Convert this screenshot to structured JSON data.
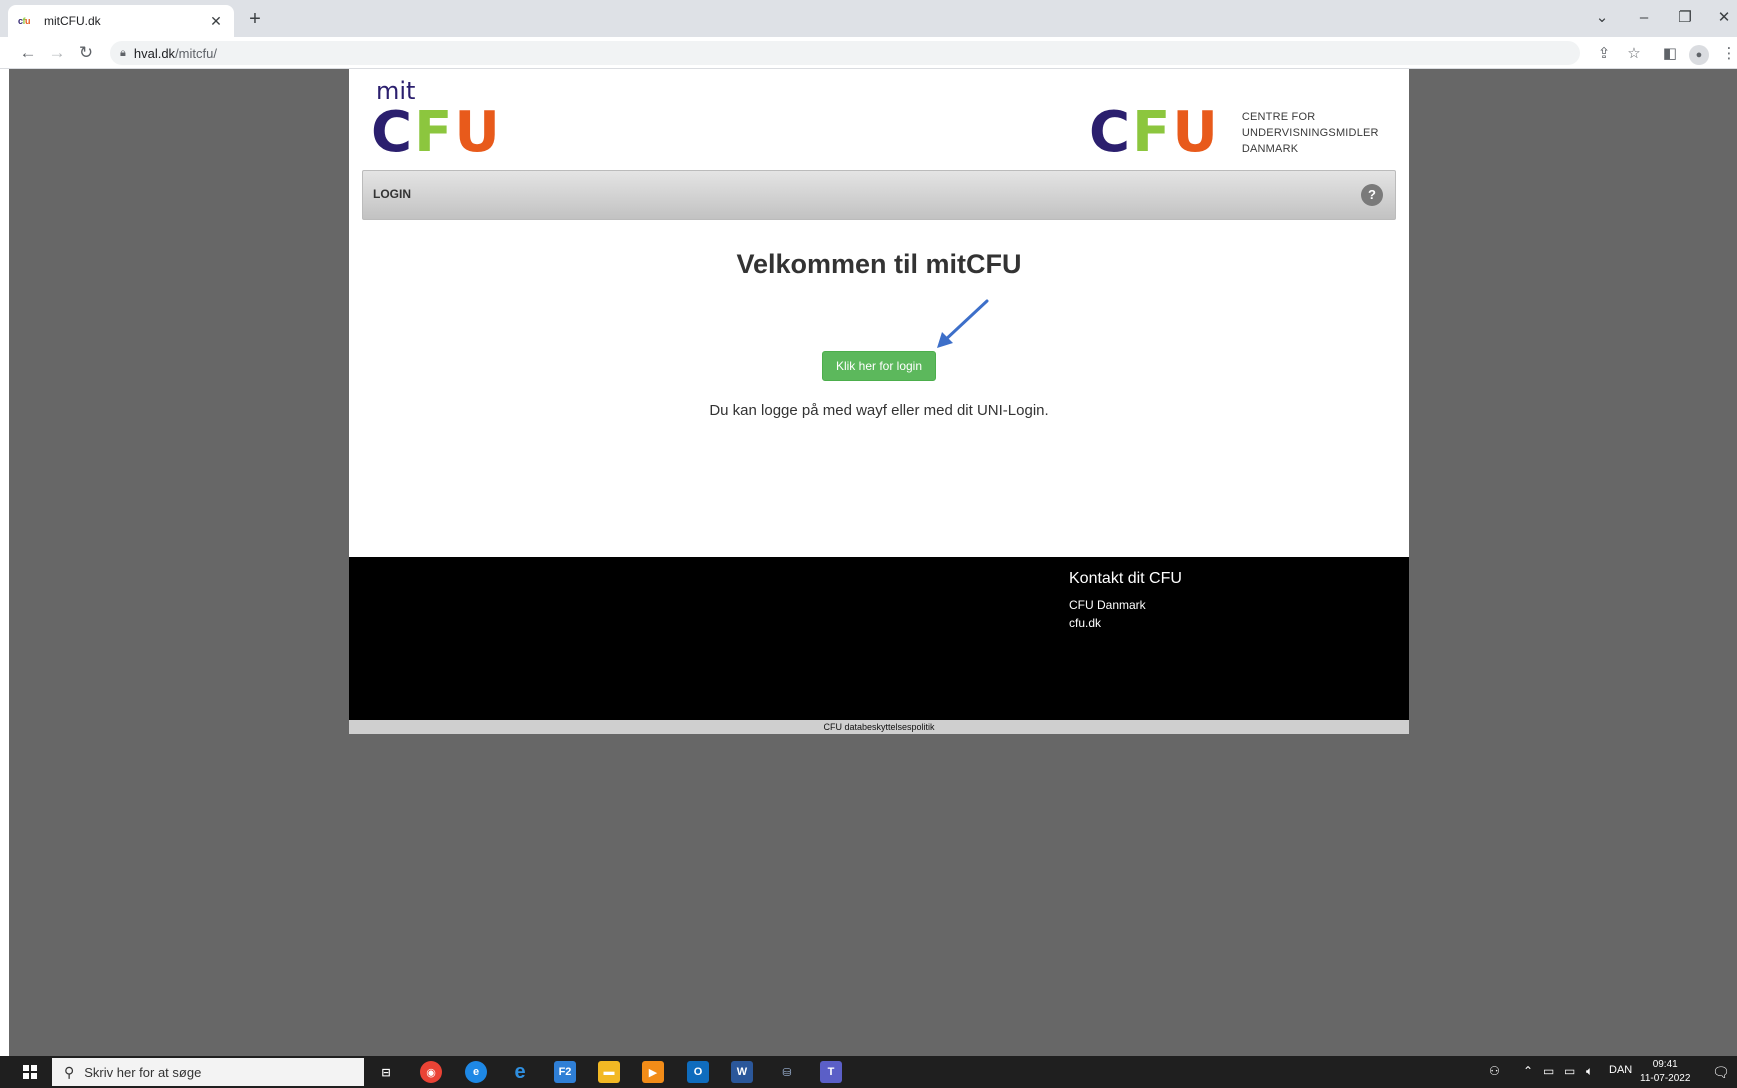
{
  "browser": {
    "tab_title": "mitCFU.dk",
    "tab_favicon": "cfu",
    "url_host": "hval.dk",
    "url_path": "/mitcfu/"
  },
  "header": {
    "logo_mit": "mit",
    "logo_c": "C",
    "logo_f": "F",
    "logo_u": "U",
    "right_logo_line1": "CENTRE FOR",
    "right_logo_line2": "UNDERVISNINGSMIDLER",
    "right_logo_line3": "DANMARK"
  },
  "loginbar": {
    "label": "LOGIN",
    "help": "?"
  },
  "main": {
    "title": "Velkommen til mitCFU",
    "login_button": "Klik her for login",
    "hint": "Du kan logge på med wayf eller med dit UNI-Login."
  },
  "footer": {
    "contact_title": "Kontakt dit CFU",
    "contact_name": "CFU Danmark",
    "contact_link": "cfu.dk",
    "privacy": "CFU databeskyttelsespolitik"
  },
  "taskbar": {
    "search_placeholder": "Skriv her for at søge",
    "language": "DAN",
    "time": "09:41",
    "date": "11-07-2022"
  },
  "colors": {
    "cfu_purple": "#2b1f6e",
    "cfu_green": "#8cc63e",
    "cfu_orange": "#e85a1b",
    "login_button_green": "#5cb85c",
    "page_background": "#676767"
  }
}
